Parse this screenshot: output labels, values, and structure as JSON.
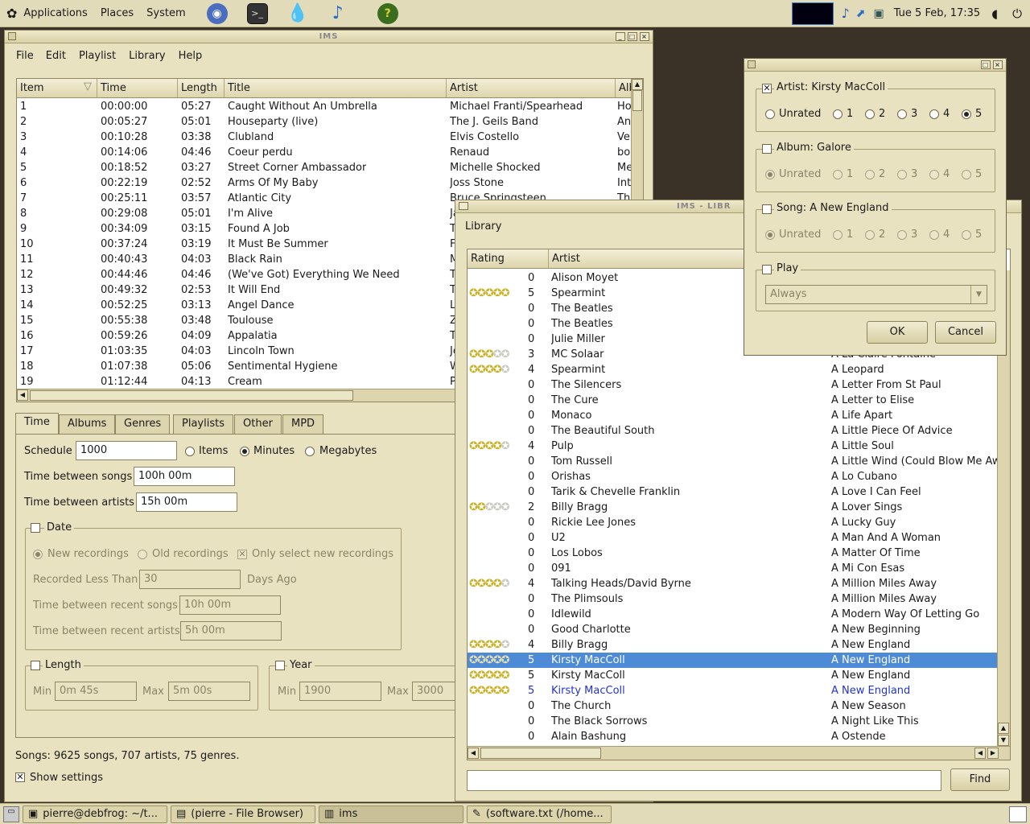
{
  "top_panel": {
    "menus": [
      "Applications",
      "Places",
      "System"
    ],
    "clock": "Tue  5 Feb, 17:35"
  },
  "main_window": {
    "title": "IMS",
    "menu": [
      "File",
      "Edit",
      "Playlist",
      "Library",
      "Help"
    ],
    "columns": [
      "Item",
      "Time",
      "Length",
      "Title",
      "Artist",
      "Alb"
    ],
    "rows": [
      [
        "1",
        "00:00:00",
        "05:27",
        "Caught Without An Umbrella",
        "Michael Franti/Spearhead",
        "Ho"
      ],
      [
        "2",
        "00:05:27",
        "05:01",
        "Houseparty (live)",
        "The J. Geils Band",
        "An"
      ],
      [
        "3",
        "00:10:28",
        "03:38",
        "Clubland",
        "Elvis Costello",
        "Ve"
      ],
      [
        "4",
        "00:14:06",
        "04:46",
        "Coeur perdu",
        "Renaud",
        "bo"
      ],
      [
        "5",
        "00:18:52",
        "03:27",
        "Street Corner Ambassador",
        "Michelle Shocked",
        "Me"
      ],
      [
        "6",
        "00:22:19",
        "02:52",
        "Arms Of My Baby",
        "Joss Stone",
        "Int"
      ],
      [
        "7",
        "00:25:11",
        "03:57",
        "Atlantic City",
        "Bruce Springsteen",
        "Th"
      ],
      [
        "8",
        "00:29:08",
        "05:01",
        "I'm Alive",
        "Ja",
        ""
      ],
      [
        "9",
        "00:34:09",
        "03:15",
        "Found A Job",
        "T",
        ""
      ],
      [
        "10",
        "00:37:24",
        "03:19",
        "It Must Be Summer",
        "F",
        ""
      ],
      [
        "11",
        "00:40:43",
        "04:03",
        "Black Rain",
        "M",
        ""
      ],
      [
        "12",
        "00:44:46",
        "04:46",
        "(We've Got) Everything We Need",
        "T",
        ""
      ],
      [
        "13",
        "00:49:32",
        "02:53",
        "It Will End",
        "T",
        ""
      ],
      [
        "14",
        "00:52:25",
        "03:13",
        "Angel Dance",
        "L",
        ""
      ],
      [
        "15",
        "00:55:38",
        "03:48",
        "Toulouse",
        "Z",
        ""
      ],
      [
        "16",
        "00:59:26",
        "04:09",
        "Appalatia",
        "T",
        ""
      ],
      [
        "17",
        "01:03:35",
        "04:03",
        "Lincoln Town",
        "Jo",
        ""
      ],
      [
        "18",
        "01:07:38",
        "05:06",
        "Sentimental Hygiene",
        "W",
        ""
      ],
      [
        "19",
        "01:12:44",
        "04:13",
        "Cream",
        "P",
        ""
      ]
    ],
    "tabs": [
      "Time",
      "Albums",
      "Genres",
      "Playlists",
      "Other",
      "MPD"
    ],
    "schedule_label": "Schedule",
    "schedule_value": "1000",
    "radio_items": "Items",
    "radio_minutes": "Minutes",
    "radio_megabytes": "Megabytes",
    "tbs_label": "Time between songs",
    "tbs_value": "100h 00m",
    "tba_label": "Time between artists",
    "tba_value": "15h 00m",
    "date_label": "Date",
    "new_rec": "New recordings",
    "old_rec": "Old recordings",
    "only_new": "Only select new recordings",
    "rlt_label": "Recorded Less Than",
    "rlt_value": "30",
    "days_ago": "Days Ago",
    "tbrs_label": "Time between recent songs",
    "tbrs_value": "10h 00m",
    "tbra_label": "Time between recent artists",
    "tbra_value": "5h 00m",
    "length_label": "Length",
    "len_min_label": "Min",
    "len_min": "0m 45s",
    "len_max_label": "Max",
    "len_max": "5m 00s",
    "year_label": "Year",
    "year_min_label": "Min",
    "year_min": "1900",
    "year_max_label": "Max",
    "year_max": "3000",
    "status": "Songs: 9625 songs, 707 artists, 75 genres.",
    "show_settings": "Show settings"
  },
  "library_window": {
    "title": "IMS - LIBR",
    "heading": "Library",
    "columns": [
      "Rating",
      "Artist"
    ],
    "rows": [
      {
        "r": 0,
        "artist": "Alison Moyet",
        "title": ""
      },
      {
        "r": 5,
        "artist": "Spearmint",
        "title": ""
      },
      {
        "r": 0,
        "artist": "The Beatles",
        "title": ""
      },
      {
        "r": 0,
        "artist": "The Beatles",
        "title": ""
      },
      {
        "r": 0,
        "artist": "Julie Miller",
        "title": ""
      },
      {
        "r": 3,
        "artist": "MC Solaar",
        "title": "A La Claire Fontaine"
      },
      {
        "r": 4,
        "artist": "Spearmint",
        "title": "A Leopard"
      },
      {
        "r": 0,
        "artist": "The Silencers",
        "title": "A Letter From St Paul"
      },
      {
        "r": 0,
        "artist": "The Cure",
        "title": "A Letter to Elise"
      },
      {
        "r": 0,
        "artist": "Monaco",
        "title": "A Life Apart"
      },
      {
        "r": 0,
        "artist": "The Beautiful South",
        "title": "A Little Piece Of Advice"
      },
      {
        "r": 4,
        "artist": "Pulp",
        "title": "A Little Soul"
      },
      {
        "r": 0,
        "artist": "Tom Russell",
        "title": "A Little Wind (Could Blow Me Awa"
      },
      {
        "r": 0,
        "artist": "Orishas",
        "title": "A Lo Cubano"
      },
      {
        "r": 0,
        "artist": "Tarik & Chevelle Franklin",
        "title": "A Love I Can Feel"
      },
      {
        "r": 2,
        "artist": "Billy Bragg",
        "title": "A Lover Sings"
      },
      {
        "r": 0,
        "artist": "Rickie Lee Jones",
        "title": "A Lucky Guy"
      },
      {
        "r": 0,
        "artist": "U2",
        "title": "A Man And A Woman"
      },
      {
        "r": 0,
        "artist": "Los Lobos",
        "title": "A Matter Of Time"
      },
      {
        "r": 0,
        "artist": "091",
        "title": "A Mi Con Esas"
      },
      {
        "r": 4,
        "artist": "Talking Heads/David Byrne",
        "title": "A Million Miles Away"
      },
      {
        "r": 0,
        "artist": "The Plimsouls",
        "title": "A Million Miles Away"
      },
      {
        "r": 0,
        "artist": "Idlewild",
        "title": "A Modern Way Of Letting Go"
      },
      {
        "r": 0,
        "artist": "Good Charlotte",
        "title": "A New Beginning"
      },
      {
        "r": 4,
        "artist": "Billy Bragg",
        "title": "A New England"
      },
      {
        "r": 5,
        "artist": "Kirsty MacColl",
        "title": "A New England",
        "sel": true
      },
      {
        "r": 5,
        "artist": "Kirsty MacColl",
        "title": "A New England"
      },
      {
        "r": 5,
        "artist": "Kirsty MacColl",
        "title": "A New England",
        "blue": true
      },
      {
        "r": 0,
        "artist": "The Church",
        "title": "A New Season"
      },
      {
        "r": 0,
        "artist": "The Black Sorrows",
        "title": "A Night Like This"
      },
      {
        "r": 0,
        "artist": "Alain Bashung",
        "title": "A Ostende"
      }
    ],
    "find_label": "Find"
  },
  "rating_dialog": {
    "artist_label": "Artist: Kirsty MacColl",
    "album_label": "Album: Galore",
    "song_label": "Song: A New England",
    "play_label": "Play",
    "play_value": "Always",
    "unrated": "Unrated",
    "levels": [
      "1",
      "2",
      "3",
      "4",
      "5"
    ],
    "ok": "OK",
    "cancel": "Cancel"
  },
  "taskbar": [
    "pierre@debfrog: ~/t...",
    "(pierre - File Browser)",
    "ims",
    "(software.txt (/home..."
  ]
}
